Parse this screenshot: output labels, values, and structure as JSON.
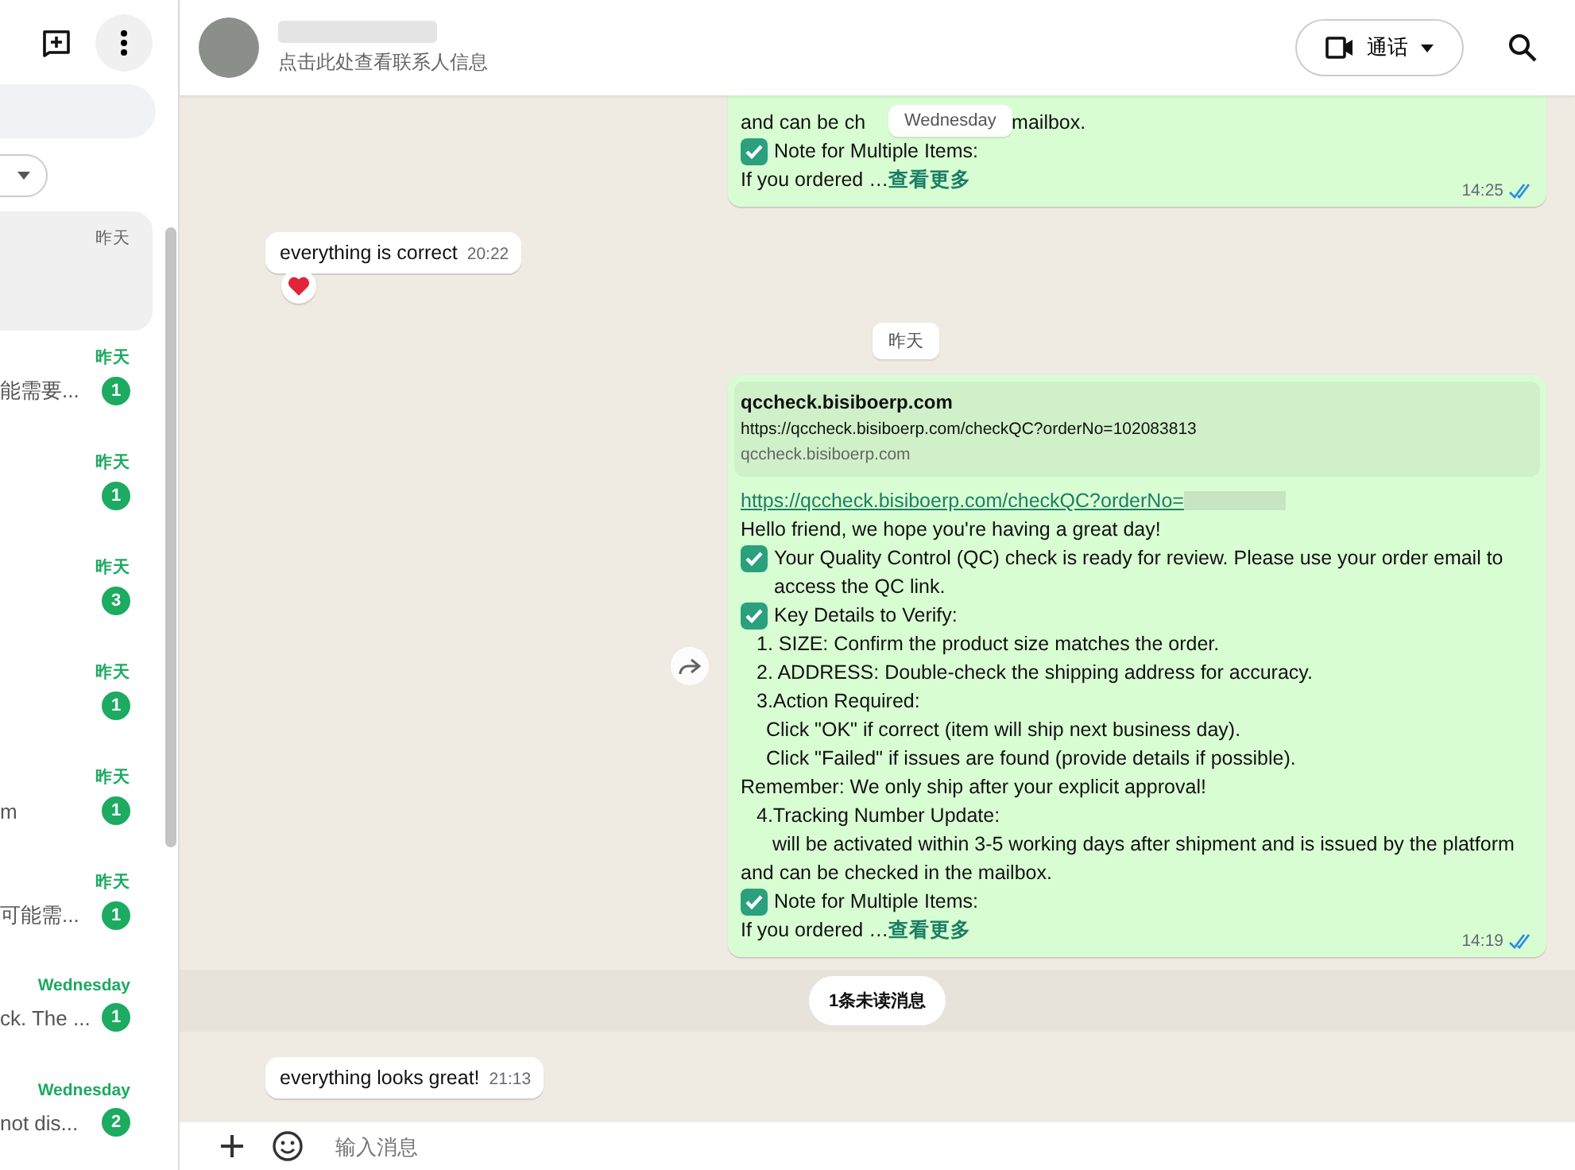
{
  "sidebar": {
    "chats": [
      {
        "time": "昨天",
        "selected": true,
        "unread": false
      },
      {
        "time": "昨天",
        "preview": "能需要...",
        "badge": "1",
        "selected": false,
        "unread": true
      },
      {
        "time": "昨天",
        "badge": "1",
        "selected": false,
        "unread": true
      },
      {
        "time": "昨天",
        "badge": "3",
        "selected": false,
        "unread": true
      },
      {
        "time": "昨天",
        "badge": "1",
        "selected": false,
        "unread": true
      },
      {
        "time": "昨天",
        "preview": "m",
        "badge": "1",
        "selected": false,
        "unread": true
      },
      {
        "time": "昨天",
        "preview": "可能需...",
        "badge": "1",
        "selected": false,
        "unread": true
      },
      {
        "time": "Wednesday",
        "preview": "ck. The ...",
        "badge": "1",
        "selected": false,
        "unread": true
      },
      {
        "time": "Wednesday",
        "preview": "not dis...",
        "badge": "2",
        "selected": false,
        "unread": true
      }
    ]
  },
  "header": {
    "subtitle": "点击此处查看联系人信息",
    "call_button": "通话"
  },
  "sticky_date": "Wednesday",
  "messages": [
    {
      "kind": "outgoing",
      "lines": [
        {
          "kind": "split",
          "text": "and can be ch",
          "tail": "mailbox."
        },
        {
          "kind": "check",
          "text": "Note for Multiple Items:"
        },
        {
          "kind": "more",
          "text": "If you ordered …",
          "link": "查看更多"
        }
      ],
      "time": "14:25",
      "read": true
    },
    {
      "kind": "incoming",
      "text": "everything is correct",
      "time": "20:22",
      "reaction": true
    },
    {
      "kind": "date",
      "text": "昨天"
    },
    {
      "kind": "outgoing",
      "forward": true,
      "preview": {
        "title": "qccheck.bisiboerp.com",
        "url": "https://qccheck.bisiboerp.com/checkQC?orderNo=102083813",
        "domain": "qccheck.bisiboerp.com"
      },
      "lines": [
        {
          "kind": "link",
          "text": "https://qccheck.bisiboerp.com/checkQC?orderNo="
        },
        {
          "kind": "text",
          "text": "Hello friend, we hope you're having a great day!"
        },
        {
          "kind": "check",
          "text": "Your Quality Control (QC) check is ready for review. Please use your order email to access the QC link."
        },
        {
          "kind": "check",
          "text": "Key Details to Verify:"
        },
        {
          "kind": "indent1",
          "text": "1. SIZE: Confirm the product size matches the order."
        },
        {
          "kind": "indent1",
          "text": "2. ADDRESS: Double-check the shipping address for accuracy."
        },
        {
          "kind": "indent1",
          "text": "3.Action Required:"
        },
        {
          "kind": "indent2",
          "text": "Click \"OK\" if correct (item will ship next business day)."
        },
        {
          "kind": "indent2",
          "text": "Click \"Failed\" if issues are found (provide details if possible)."
        },
        {
          "kind": "text",
          "text": "Remember: We only ship after your explicit approval!"
        },
        {
          "kind": "indent1",
          "text": "4.Tracking Number Update:"
        },
        {
          "kind": "indent3",
          "text": "will be activated within 3-5 working days after shipment and is issued by the platform and can be checked in the mailbox."
        },
        {
          "kind": "check",
          "text": "Note for Multiple Items:"
        },
        {
          "kind": "more",
          "text": "If you ordered …",
          "link": "查看更多"
        }
      ],
      "time": "14:19",
      "read": true
    },
    {
      "kind": "unread",
      "text": "1条未读消息"
    },
    {
      "kind": "incoming",
      "text": "everything looks great!",
      "time": "21:13",
      "reaction": false
    }
  ],
  "composer": {
    "placeholder": "输入消息"
  }
}
